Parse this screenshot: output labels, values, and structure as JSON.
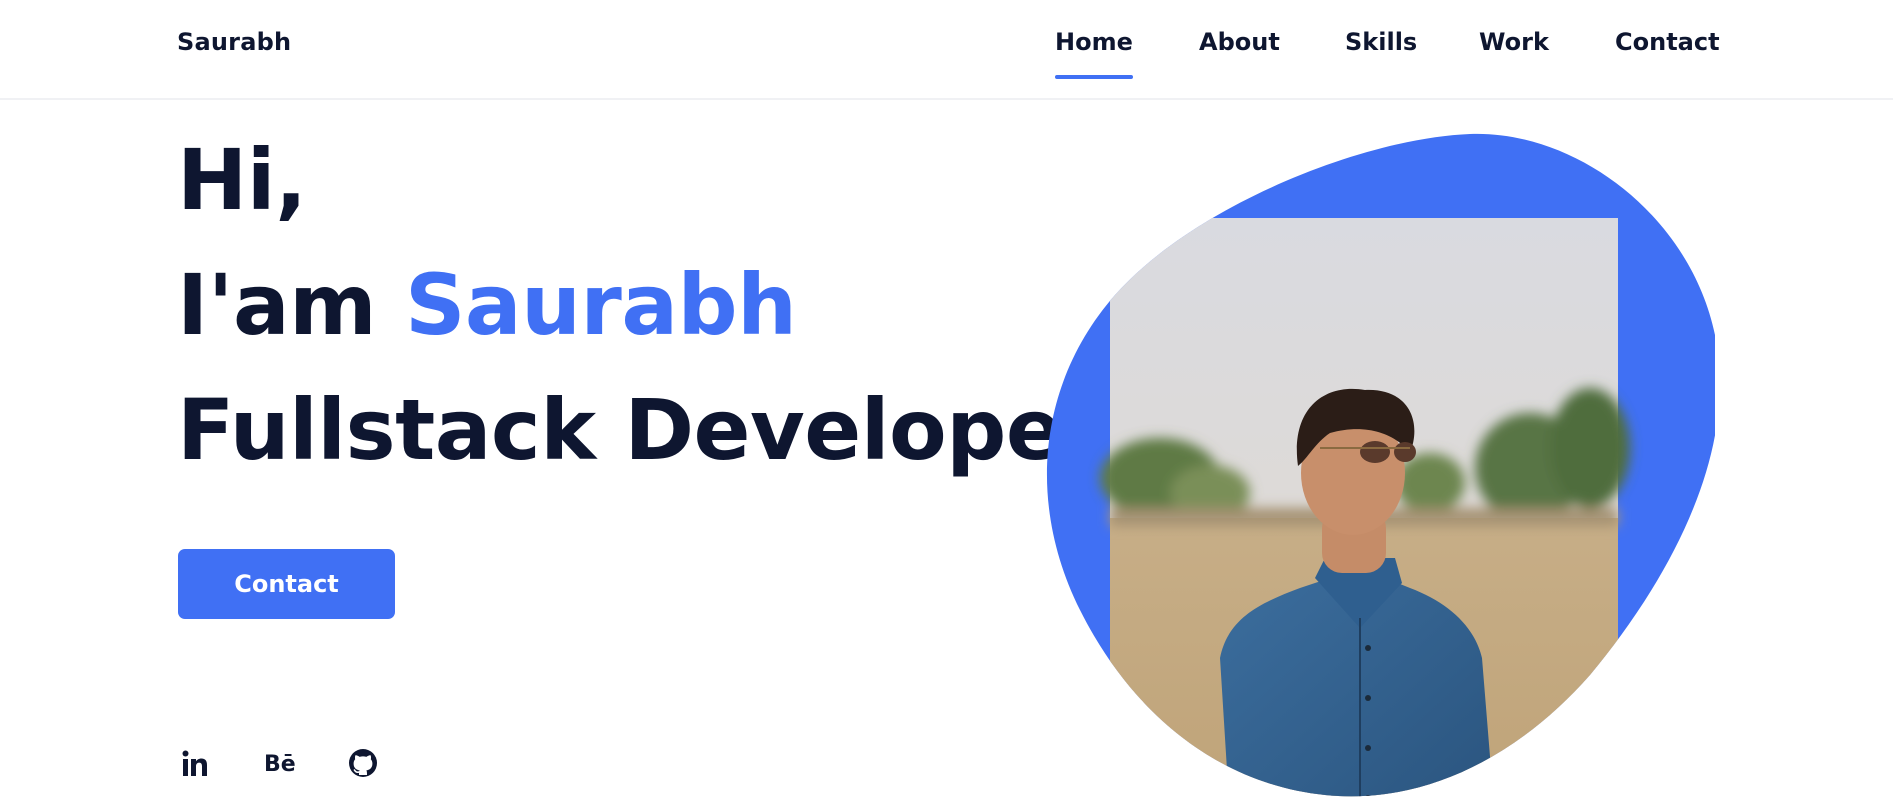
{
  "header": {
    "logo": "Saurabh",
    "nav": [
      {
        "label": "Home",
        "active": true
      },
      {
        "label": "About",
        "active": false
      },
      {
        "label": "Skills",
        "active": false
      },
      {
        "label": "Work",
        "active": false
      },
      {
        "label": "Contact",
        "active": false
      }
    ]
  },
  "hero": {
    "line1": "Hi,",
    "line2_prefix": "I'am ",
    "line2_name": "Saurabh",
    "line3": "Fullstack Developer",
    "cta_label": "Contact"
  },
  "social": [
    {
      "icon": "linkedin-icon"
    },
    {
      "icon": "behance-icon"
    },
    {
      "icon": "github-icon"
    }
  ],
  "colors": {
    "accent": "#4070f4",
    "text": "#0e1630",
    "background": "#ffffff"
  }
}
